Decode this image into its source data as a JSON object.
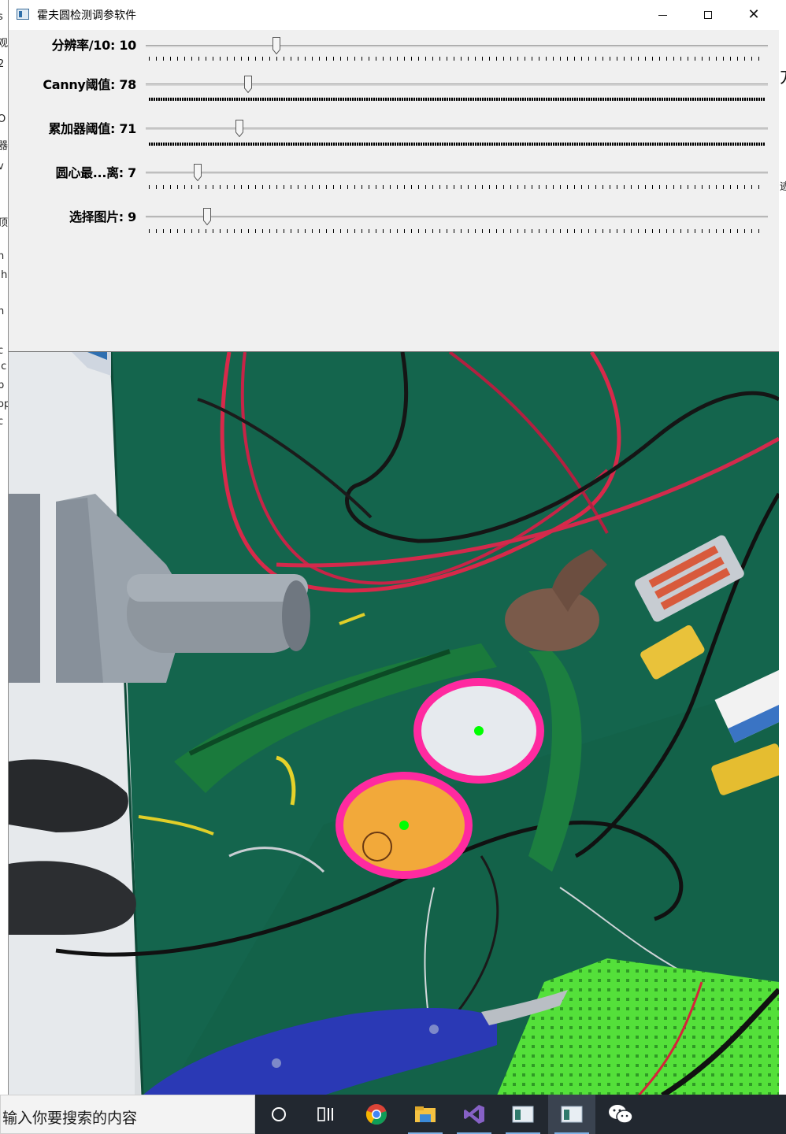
{
  "window": {
    "title": "霍夫圆检测调参软件",
    "title_icon": "app-window-icon",
    "controls": {
      "minimize": "minimize-icon",
      "maximize": "maximize-icon",
      "close": "close-icon"
    }
  },
  "trackbars": [
    {
      "label": "分辨率/10: 10",
      "value": 10,
      "position": 0.21
    },
    {
      "label": "Canny阈值: 78",
      "value": 78,
      "position": 0.165
    },
    {
      "label": "累加器阈值: 71",
      "value": 71,
      "position": 0.15
    },
    {
      "label": "圆心最...离: 7",
      "value": 7,
      "position": 0.083
    },
    {
      "label": "选择图片: 9",
      "value": 9,
      "position": 0.099
    }
  ],
  "image": {
    "description_icon": "hough-circle-result-image",
    "circle_color": "#ff2aa0",
    "center_color": "#00ff00"
  },
  "taskbar": {
    "search_placeholder": "输入你要搜索的内容",
    "icons": [
      "cortana-icon",
      "task-view-icon",
      "chrome-icon",
      "file-explorer-icon",
      "visual-studio-icon",
      "app-window-icon",
      "app-window-icon",
      "wechat-icon"
    ]
  },
  "background": {
    "left_fragments": [
      "s",
      "观",
      "2",
      "O",
      "器",
      "v",
      "顶",
      "h",
      ".h",
      "h",
      "c",
      ".c",
      "p",
      "op",
      "c"
    ],
    "right_fragments": [
      "方",
      "迹"
    ]
  }
}
